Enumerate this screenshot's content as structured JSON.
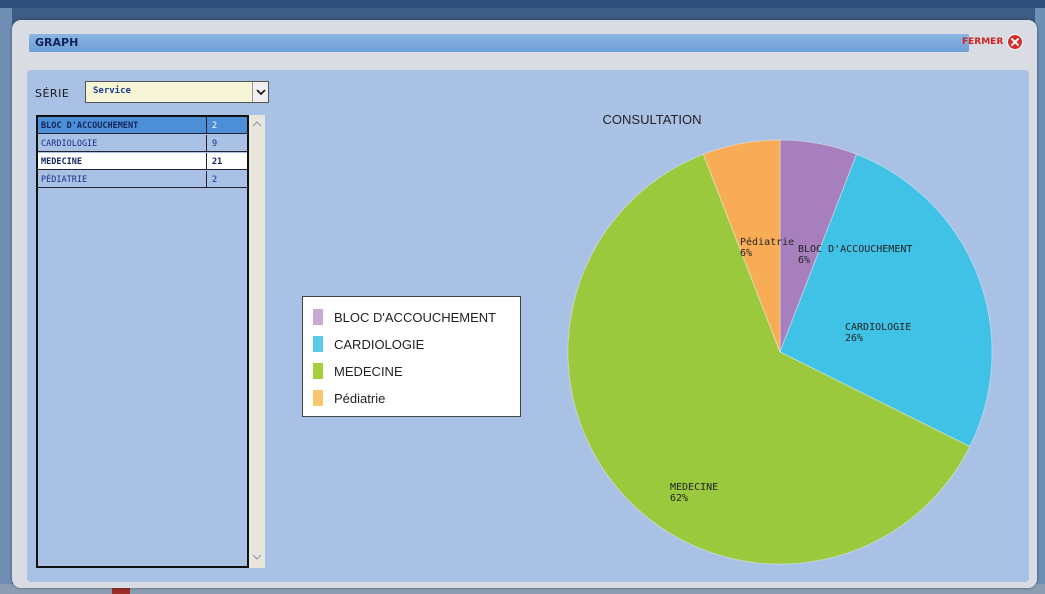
{
  "window": {
    "title": "GRAPH",
    "close_label": "FERMER"
  },
  "serie": {
    "label": "SÉRIE",
    "selected": "Service"
  },
  "table": {
    "rows": [
      {
        "name": "BLOC D'ACCOUCHEMENT",
        "value": "2"
      },
      {
        "name": "CARDIOLOGIE",
        "value": "9"
      },
      {
        "name": "MEDECINE",
        "value": "21"
      },
      {
        "name": "PÉDIATRIE",
        "value": "2"
      }
    ]
  },
  "colors": {
    "bloc": "#a77fbd",
    "cardiologie": "#3fc2e6",
    "medecine": "#9ac93d",
    "pediatrie": "#f7ac55"
  },
  "chart_data": {
    "type": "pie",
    "title": "CONSULTATION",
    "categories": [
      "BLOC D'ACCOUCHEMENT",
      "CARDIOLOGIE",
      "MEDECINE",
      "Pédiatrie"
    ],
    "values": [
      2,
      9,
      21,
      2
    ],
    "percent_labels": [
      "6%",
      "26%",
      "62%",
      "6%"
    ],
    "slice_labels": [
      "BLOC D'ACCOUCHEMENT",
      "CARDIOLOGIE",
      "MEDECINE",
      "Pédiatrie"
    ],
    "legend": [
      "BLOC D'ACCOUCHEMENT",
      "CARDIOLOGIE",
      "MEDECINE",
      "Pédiatrie"
    ],
    "legend_placement": "left"
  }
}
